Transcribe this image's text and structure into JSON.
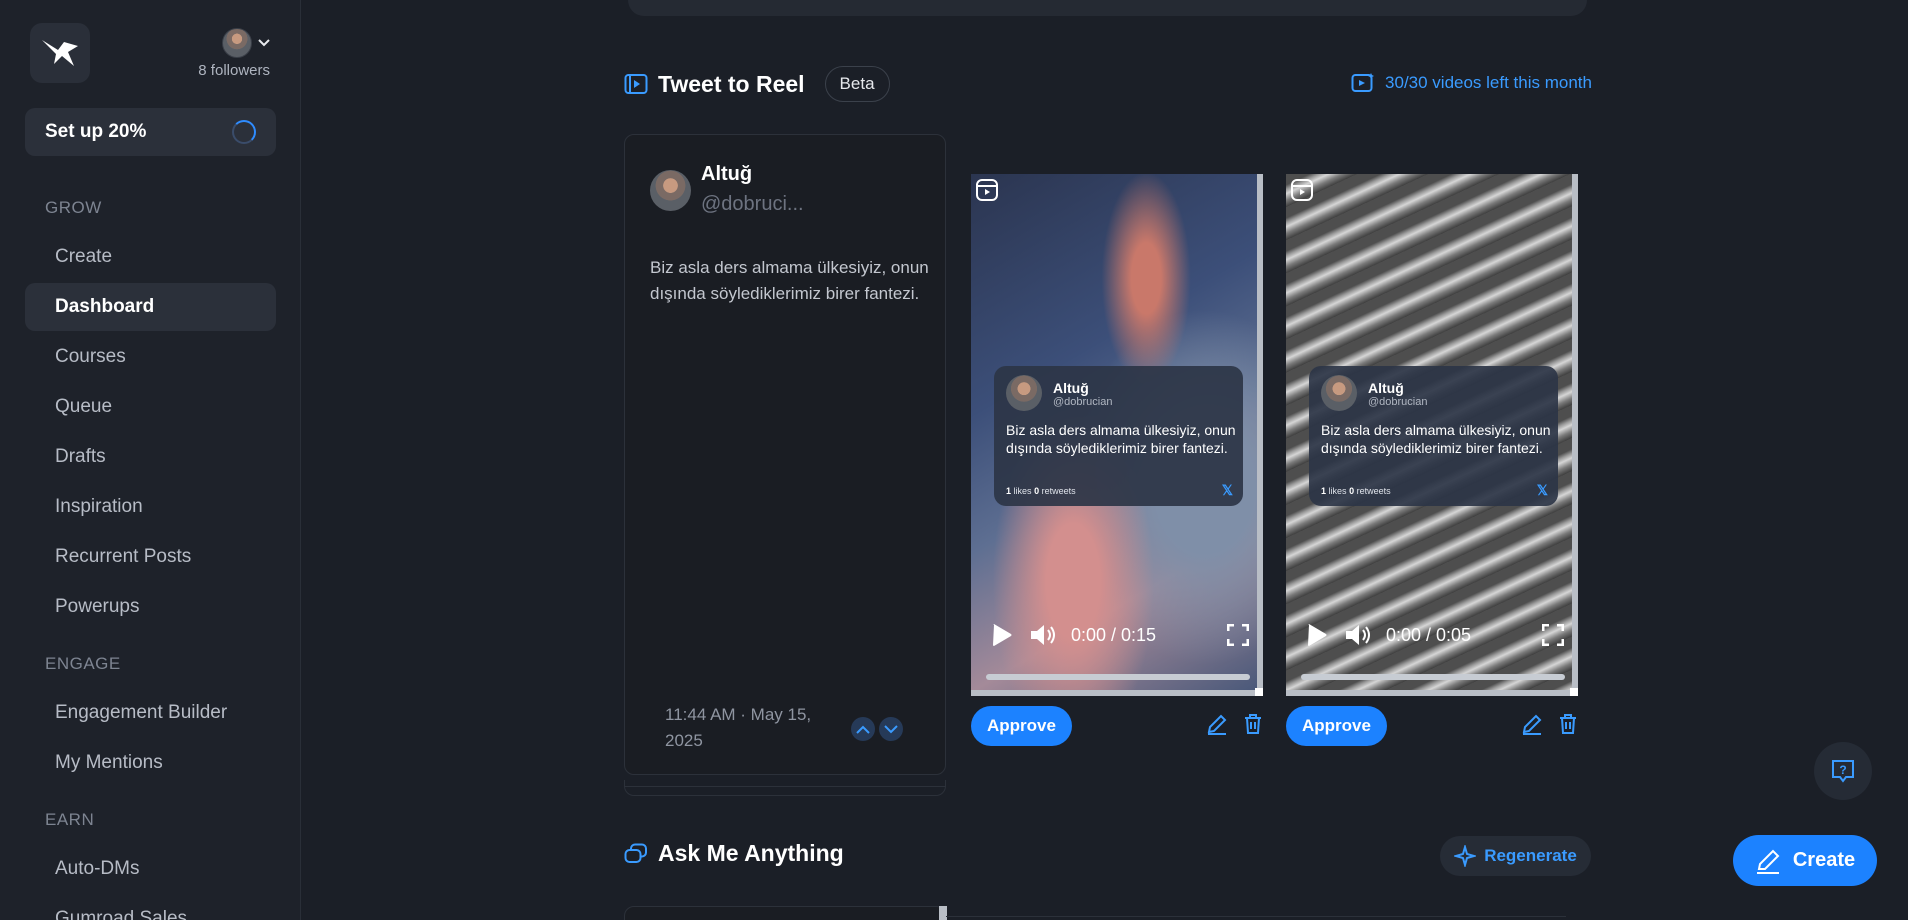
{
  "account": {
    "followers": "8 followers"
  },
  "setup": {
    "label": "Set up 20%"
  },
  "sidebar": {
    "sections": [
      {
        "label": "GROW"
      },
      {
        "label": "ENGAGE"
      },
      {
        "label": "EARN"
      }
    ],
    "items": [
      {
        "label": "Create"
      },
      {
        "label": "Dashboard",
        "active": true
      },
      {
        "label": "Courses"
      },
      {
        "label": "Queue"
      },
      {
        "label": "Drafts"
      },
      {
        "label": "Inspiration"
      },
      {
        "label": "Recurrent Posts"
      },
      {
        "label": "Powerups"
      },
      {
        "label": "Engagement Builder"
      },
      {
        "label": "My Mentions"
      },
      {
        "label": "Auto-DMs"
      },
      {
        "label": "Gumroad Sales"
      }
    ]
  },
  "tweet_to_reel": {
    "title": "Tweet to Reel",
    "badge": "Beta",
    "quota": "30/30 videos left this month",
    "tweet": {
      "name": "Altuğ",
      "handle": "@dobruci...",
      "text": "Biz asla ders almama ülkesiyiz, onun dışında söylediklerimiz birer fantezi.",
      "time": "11:44 AM · May 15, 2025"
    },
    "videos": [
      {
        "overlay": {
          "name": "Altuğ",
          "handle": "@dobrucian",
          "text": "Biz asla ders almama ülkesiyiz, onun dışında söylediklerimiz birer fantezi.",
          "likes": "1",
          "likes_label": "likes",
          "retweets": "0",
          "retweets_label": "retweets"
        },
        "time": "0:00 / 0:15",
        "approve_label": "Approve"
      },
      {
        "overlay": {
          "name": "Altuğ",
          "handle": "@dobrucian",
          "text": "Biz asla ders almama ülkesiyiz, onun dışında söylediklerimiz birer fantezi.",
          "likes": "1",
          "likes_label": "likes",
          "retweets": "0",
          "retweets_label": "retweets"
        },
        "time": "0:00 / 0:05",
        "approve_label": "Approve"
      }
    ]
  },
  "ama": {
    "title": "Ask Me Anything",
    "regenerate_label": "Regenerate"
  },
  "fab": {
    "create_label": "Create"
  },
  "colors": {
    "accent": "#1c82ff",
    "link": "#3a9bff",
    "background": "#1b1f27"
  }
}
